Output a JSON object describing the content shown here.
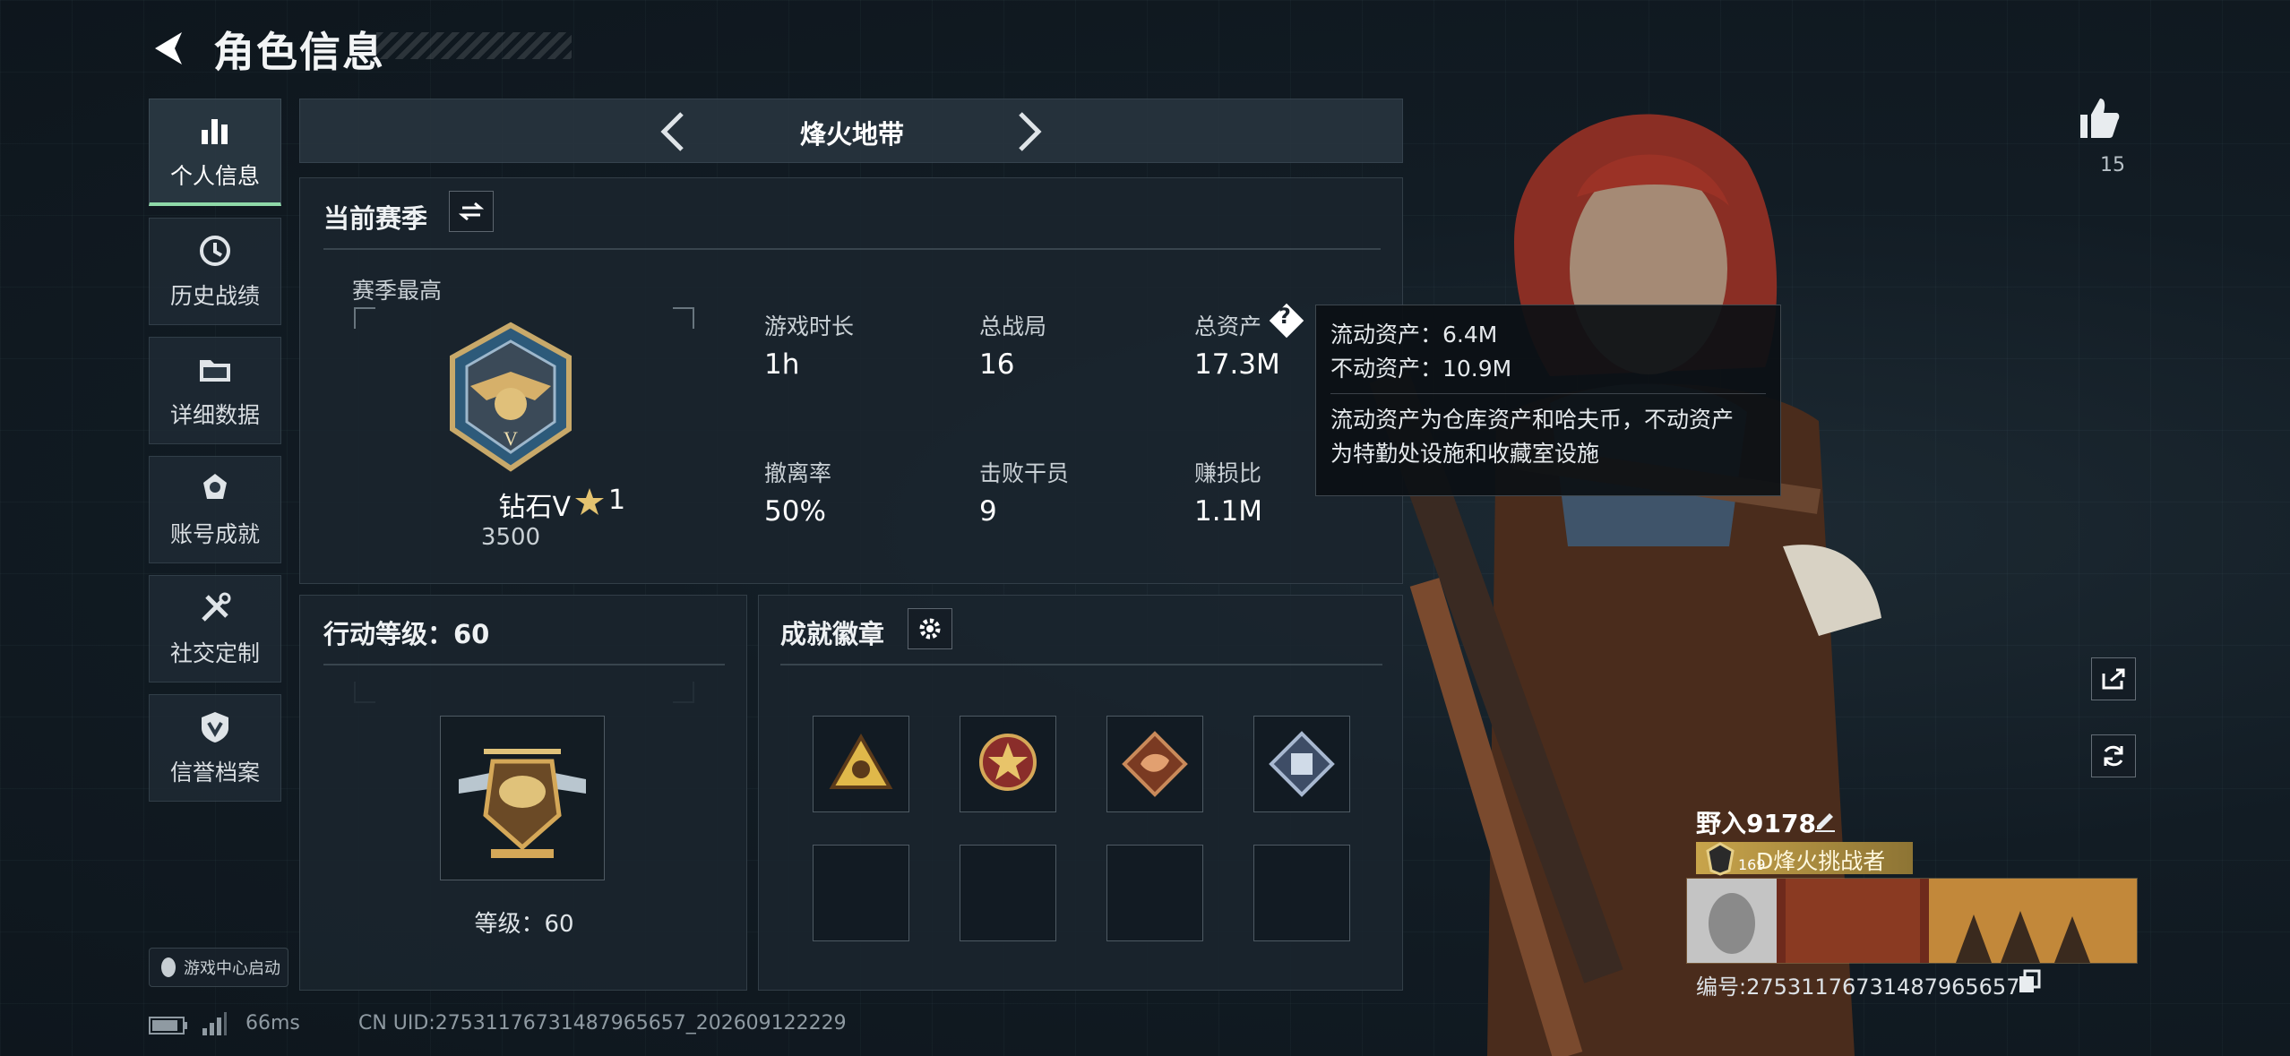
{
  "header": {
    "title": "角色信息"
  },
  "sidebar": {
    "items": [
      {
        "label": "个人信息",
        "icon": "bar-chart-icon",
        "active": true
      },
      {
        "label": "历史战绩",
        "icon": "history-clock-icon"
      },
      {
        "label": "详细数据",
        "icon": "folder-icon"
      },
      {
        "label": "账号成就",
        "icon": "achievement-icon"
      },
      {
        "label": "社交定制",
        "icon": "tools-icon"
      },
      {
        "label": "信誉档案",
        "icon": "shield-icon"
      }
    ],
    "launch_label": "游戏中心启动"
  },
  "mode": {
    "title": "烽火地带"
  },
  "season": {
    "title": "当前赛季",
    "highest_label": "赛季最高",
    "rank_name": "钻石V",
    "rank_stars": "1",
    "rank_points": "3500",
    "stats": [
      {
        "label": "游戏时长",
        "value": "1h"
      },
      {
        "label": "总战局",
        "value": "16"
      },
      {
        "label": "总资产",
        "value": "17.3M"
      },
      {
        "label": "撤离率",
        "value": "50%"
      },
      {
        "label": "击败干员",
        "value": "9"
      },
      {
        "label": "赚损比",
        "value": "1.1M"
      }
    ]
  },
  "tooltip": {
    "liquid": "流动资产：6.4M",
    "fixed": "不动资产：10.9M",
    "desc_line1": "流动资产为仓库资产和哈夫币，不动资产",
    "desc_line2": "为特勤处设施和收藏室设施"
  },
  "action_level": {
    "title": "行动等级：60",
    "level_text": "等级：60"
  },
  "achievements": {
    "title": "成就徽章"
  },
  "profile": {
    "likes": "15",
    "nickname": "野入9178",
    "title_level": "169",
    "title_text": "D烽火挑战者",
    "id_text": "编号:27531176731487965657"
  },
  "footer": {
    "ping": "66ms",
    "uid": "CN UID:27531176731487965657_202609122229"
  },
  "colors": {
    "accent_green": "#8fd9a8",
    "gold": "#c8a44b"
  }
}
